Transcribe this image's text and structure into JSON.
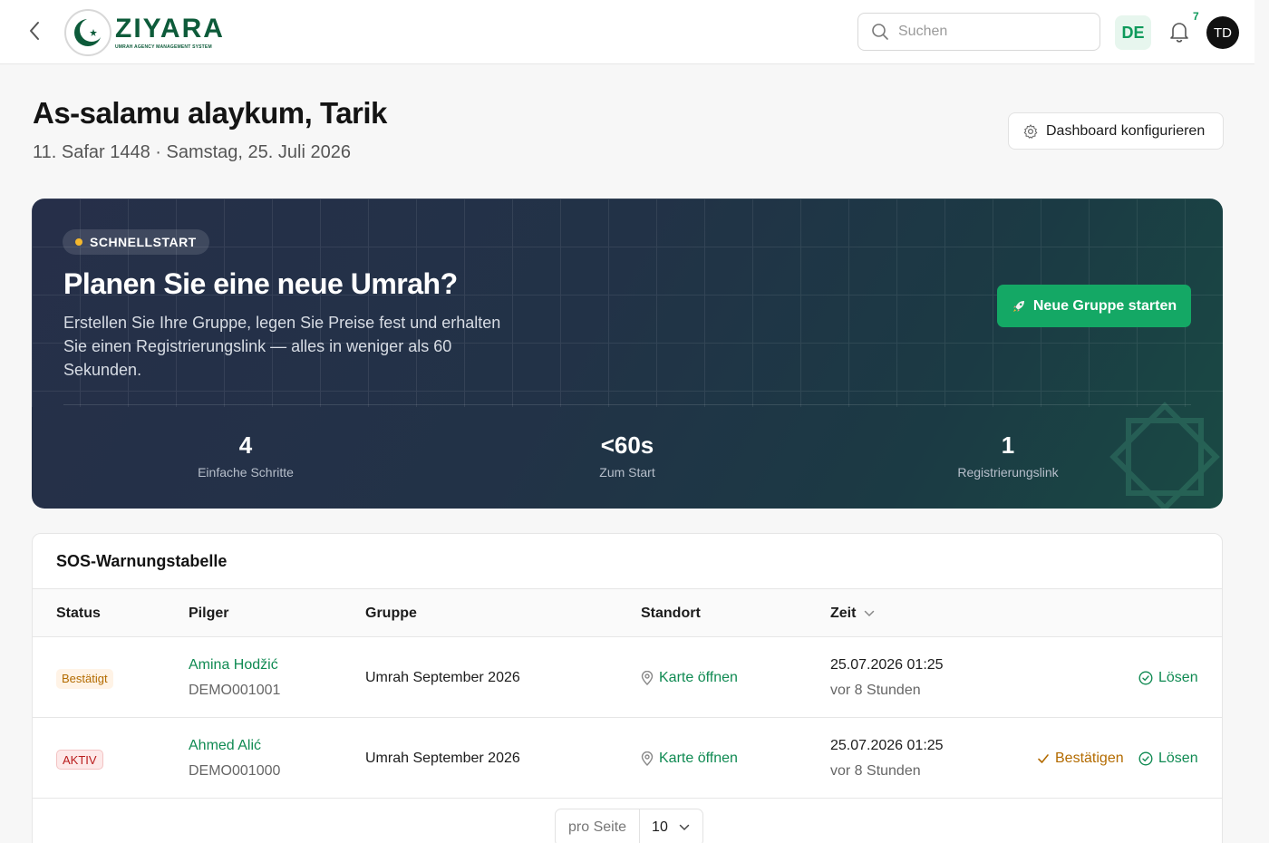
{
  "header": {
    "logo_name": "ZIYARA",
    "logo_subtitle": "UMRAH AGENCY MANAGEMENT SYSTEM",
    "search_placeholder": "Suchen",
    "language": "DE",
    "notification_count": "7",
    "avatar_initials": "TD"
  },
  "greeting": {
    "title": "As-salamu alaykum, Tarik",
    "date": "11. Safar 1448 · Samstag, 25. Juli 2026",
    "configure_label": "Dashboard konfigurieren"
  },
  "hero": {
    "badge": "SCHNELLSTART",
    "title": "Planen Sie eine neue Umrah?",
    "description": "Erstellen Sie Ihre Gruppe, legen Sie Preise fest und erhalten Sie einen Registrierungslink — alles in weniger als 60 Sekunden.",
    "cta_label": "Neue Gruppe starten",
    "stats": [
      {
        "value": "4",
        "label": "Einfache Schritte"
      },
      {
        "value": "<60s",
        "label": "Zum Start"
      },
      {
        "value": "1",
        "label": "Registrierungslink"
      }
    ]
  },
  "sos_table": {
    "title": "SOS-Warnungstabelle",
    "columns": [
      "Status",
      "Pilger",
      "Gruppe",
      "Standort",
      "Zeit"
    ],
    "rows": [
      {
        "status": "Bestätigt",
        "name": "Amina Hodžić",
        "id": "DEMO001001",
        "group": "Umrah September 2026",
        "location": "Karte öffnen",
        "time": "25.07.2026 01:25",
        "ago": "vor 8 Stunden",
        "resolve": "Lösen"
      },
      {
        "status": "AKTIV",
        "name": "Ahmed Alić",
        "id": "DEMO001000",
        "group": "Umrah September 2026",
        "location": "Karte öffnen",
        "time": "25.07.2026 01:25",
        "ago": "vor 8 Stunden",
        "confirm": "Bestätigen",
        "resolve": "Lösen"
      }
    ],
    "pager": {
      "per_page_label": "pro Seite",
      "per_page_value": "10"
    }
  },
  "colors": {
    "brand_green": "#0d5b3a",
    "accent_green": "#14a865",
    "warning": "#b36b00",
    "danger": "#b91c1c",
    "hero_bg": "#223247"
  }
}
